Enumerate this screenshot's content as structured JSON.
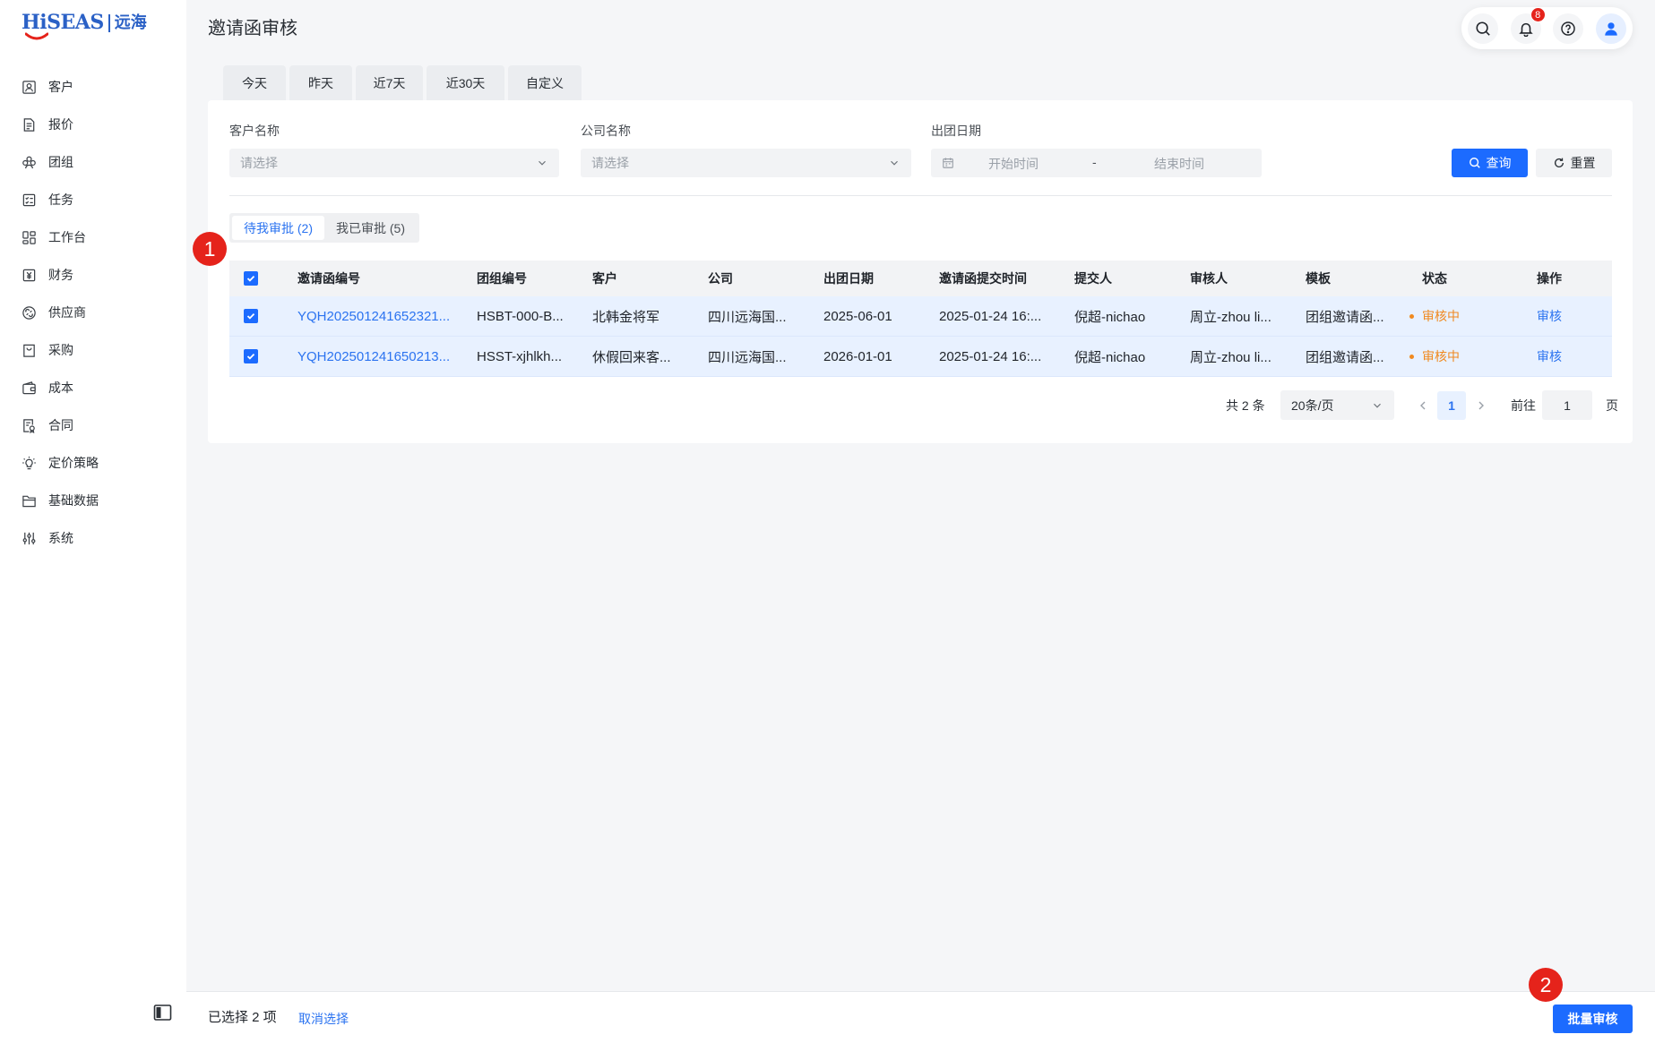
{
  "app": {
    "logo_text": "HiSEAS",
    "logo_cn": "远海"
  },
  "sidebar": {
    "items": [
      {
        "label": "客户",
        "icon": "customer-icon"
      },
      {
        "label": "报价",
        "icon": "quote-icon"
      },
      {
        "label": "团组",
        "icon": "group-icon"
      },
      {
        "label": "任务",
        "icon": "task-icon"
      },
      {
        "label": "工作台",
        "icon": "workbench-icon"
      },
      {
        "label": "财务",
        "icon": "finance-icon"
      },
      {
        "label": "供应商",
        "icon": "supplier-icon"
      },
      {
        "label": "采购",
        "icon": "purchase-icon"
      },
      {
        "label": "成本",
        "icon": "cost-icon"
      },
      {
        "label": "合同",
        "icon": "contract-icon"
      },
      {
        "label": "定价策略",
        "icon": "pricing-strategy-icon"
      },
      {
        "label": "基础数据",
        "icon": "base-data-icon"
      },
      {
        "label": "系统",
        "icon": "system-icon"
      }
    ],
    "collapse_icon": "sidebar-collapse-icon"
  },
  "header": {
    "title": "邀请函审核",
    "notification_count": "8",
    "icons": [
      "search-icon",
      "bell-icon",
      "help-icon",
      "user-avatar-icon"
    ]
  },
  "date_tabs": [
    {
      "label": "今天"
    },
    {
      "label": "昨天"
    },
    {
      "label": "近7天"
    },
    {
      "label": "近30天"
    },
    {
      "label": "自定义"
    }
  ],
  "filters": {
    "customer": {
      "label": "客户名称",
      "placeholder": "请选择"
    },
    "company": {
      "label": "公司名称",
      "placeholder": "请选择"
    },
    "departure_date": {
      "label": "出团日期",
      "start_placeholder": "开始时间",
      "separator": "-",
      "end_placeholder": "结束时间"
    },
    "search_button": "查询",
    "reset_button": "重置"
  },
  "approval_tabs": [
    {
      "label": "待我审批 (2)",
      "active": true
    },
    {
      "label": "我已审批 (5)",
      "active": false
    }
  ],
  "table": {
    "all_selected": true,
    "columns": [
      "邀请函编号",
      "团组编号",
      "客户",
      "公司",
      "出团日期",
      "邀请函提交时间",
      "提交人",
      "审核人",
      "模板",
      "状态",
      "操作"
    ],
    "rows": [
      {
        "selected": true,
        "invite_no": "YQH202501241652321...",
        "group_no": "HSBT-000-B...",
        "customer": "北韩金将军",
        "company": "四川远海国...",
        "departure_date": "2025-06-01",
        "submit_time": "2025-01-24 16:...",
        "submitter": "倪超-nichao",
        "reviewer": "周立-zhou li...",
        "template": "团组邀请函...",
        "status": "审核中",
        "action": "审核"
      },
      {
        "selected": true,
        "invite_no": "YQH202501241650213...",
        "group_no": "HSST-xjhlkh...",
        "customer": "休假回来客...",
        "company": "四川远海国...",
        "departure_date": "2026-01-01",
        "submit_time": "2025-01-24 16:...",
        "submitter": "倪超-nichao",
        "reviewer": "周立-zhou li...",
        "template": "团组邀请函...",
        "status": "审核中",
        "action": "审核"
      }
    ]
  },
  "pagination": {
    "total_text": "共 2 条",
    "page_size": "20条/页",
    "current_page": "1",
    "goto_label": "前往",
    "goto_value": "1",
    "page_suffix": "页"
  },
  "footer": {
    "selected_text": "已选择 2 项",
    "cancel_label": "取消选择",
    "batch_label": "批量审核"
  },
  "annotations": {
    "step1": "1",
    "step2": "2"
  },
  "theme": {
    "primary": "#1c6bff",
    "link": "#2b73f0",
    "status_pending": "#f0891f",
    "selected_row": "#e8f1ff",
    "annotation_red": "#e5231b",
    "logo_blue": "#2b61c6"
  }
}
